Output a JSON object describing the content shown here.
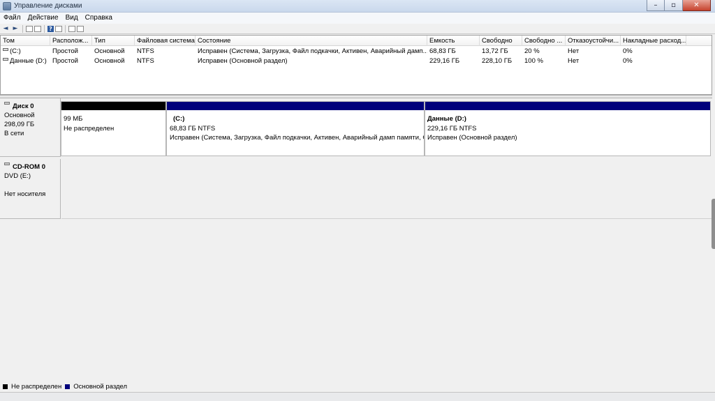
{
  "window": {
    "title": "Управление дисками",
    "minimize": "–",
    "maximize": "▫",
    "close": "✕"
  },
  "menu": [
    "Файл",
    "Действие",
    "Вид",
    "Справка"
  ],
  "toolbar": {
    "back": "◄",
    "forward": "►",
    "help": "?"
  },
  "volume_list": {
    "columns": [
      "Том",
      "Располож...",
      "Тип",
      "Файловая система",
      "Состояние",
      "Емкость",
      "Свободно",
      "Свободно ...",
      "Отказоустойчи...",
      "Накладные расход..."
    ],
    "rows": [
      [
        "(C:)",
        "Простой",
        "Основной",
        "NTFS",
        "Исправен (Система, Загрузка, Файл подкачки, Активен, Аварийный дамп...",
        "68,83 ГБ",
        "13,72 ГБ",
        "20 %",
        "Нет",
        "0%"
      ],
      [
        "Данные (D:)",
        "Простой",
        "Основной",
        "NTFS",
        "Исправен (Основной раздел)",
        "229,16 ГБ",
        "228,10 ГБ",
        "100 %",
        "Нет",
        "0%"
      ]
    ]
  },
  "disks": [
    {
      "name": "Диск 0",
      "type": "Основной",
      "size": "298,09 ГБ",
      "status": "В сети",
      "partitions": [
        {
          "title": "",
          "size": "99 МБ",
          "state": "Не распределен",
          "color": "#000000"
        },
        {
          "title": "(C:)",
          "size": "68,83 ГБ NTFS",
          "state": "Исправен (Система, Загрузка, Файл подкачки, Активен, Аварийный дамп памяти, О",
          "color": "#00007b"
        },
        {
          "title": "Данные  (D:)",
          "size": "229,16 ГБ NTFS",
          "state": "Исправен (Основной раздел)",
          "color": "#00007b"
        }
      ]
    },
    {
      "name": "CD-ROM 0",
      "type": "DVD (E:)",
      "size": "",
      "status": "Нет носителя"
    }
  ],
  "legend": [
    {
      "label": "Не распределен",
      "color": "#000000"
    },
    {
      "label": "Основной раздел",
      "color": "#00007b"
    }
  ]
}
